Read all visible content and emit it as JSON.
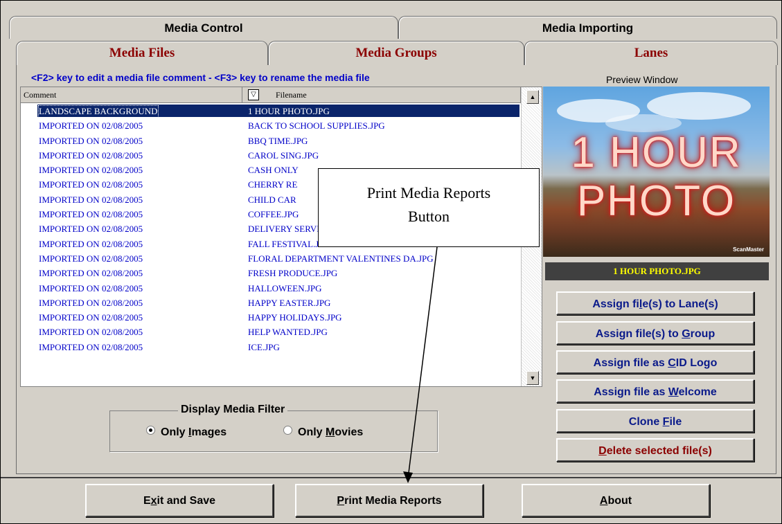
{
  "top_tabs": [
    "Media Control",
    "Media Importing"
  ],
  "sub_tabs": [
    "Media Files",
    "Media Groups",
    "Lanes"
  ],
  "hint": "<F2> key to edit a media file comment - <F3> key to rename the media file",
  "grid": {
    "columns": [
      "Comment",
      "Filename"
    ],
    "rows": [
      {
        "comment": "LANDSCAPE BACKGROUND",
        "filename": "1 HOUR PHOTO.JPG"
      },
      {
        "comment": "IMPORTED ON 02/08/2005",
        "filename": "BACK TO SCHOOL SUPPLIES.JPG"
      },
      {
        "comment": "IMPORTED ON 02/08/2005",
        "filename": "BBQ TIME.JPG"
      },
      {
        "comment": "IMPORTED ON 02/08/2005",
        "filename": "CAROL SING.JPG"
      },
      {
        "comment": "IMPORTED ON 02/08/2005",
        "filename": "CASH ONLY"
      },
      {
        "comment": "IMPORTED ON 02/08/2005",
        "filename": "CHERRY RE"
      },
      {
        "comment": "IMPORTED ON 02/08/2005",
        "filename": "CHILD CAR"
      },
      {
        "comment": "IMPORTED ON 02/08/2005",
        "filename": "COFFEE.JPG"
      },
      {
        "comment": "IMPORTED ON 02/08/2005",
        "filename": "DELIVERY SERVICE.JPG"
      },
      {
        "comment": "IMPORTED ON 02/08/2005",
        "filename": "FALL FESTIVAL.JPG"
      },
      {
        "comment": "IMPORTED ON 02/08/2005",
        "filename": "FLORAL DEPARTMENT VALENTINES DA.JPG"
      },
      {
        "comment": "IMPORTED ON 02/08/2005",
        "filename": "FRESH PRODUCE.JPG"
      },
      {
        "comment": "IMPORTED ON 02/08/2005",
        "filename": "HALLOWEEN.JPG"
      },
      {
        "comment": "IMPORTED ON 02/08/2005",
        "filename": "HAPPY EASTER.JPG"
      },
      {
        "comment": "IMPORTED ON 02/08/2005",
        "filename": "HAPPY HOLIDAYS.JPG"
      },
      {
        "comment": "IMPORTED ON 02/08/2005",
        "filename": "HELP WANTED.JPG"
      },
      {
        "comment": "IMPORTED ON 02/08/2005",
        "filename": "ICE.JPG"
      }
    ]
  },
  "filter": {
    "label": "Display Media Filter",
    "options": [
      {
        "pre": "Only ",
        "key": "I",
        "post": "mages",
        "selected": true
      },
      {
        "pre": "Only ",
        "key": "M",
        "post": "ovies",
        "selected": false
      }
    ]
  },
  "preview": {
    "label": "Preview Window",
    "line1": "1 HOUR",
    "line2": "PHOTO",
    "brand": "ScanMaster",
    "filename": "1 HOUR PHOTO.JPG"
  },
  "right_buttons": [
    {
      "pre": "Assign fi",
      "key": "l",
      "post": "e(s) to Lane(s)"
    },
    {
      "pre": "Assign file(s) to ",
      "key": "G",
      "post": "roup"
    },
    {
      "pre": "Assign file as ",
      "key": "C",
      "post": "ID Logo"
    },
    {
      "pre": "Assign file as ",
      "key": "W",
      "post": "elcome"
    },
    {
      "pre": "Clone ",
      "key": "F",
      "post": "ile"
    },
    {
      "pre": "",
      "key": "D",
      "post": "elete selected file(s)"
    }
  ],
  "bottom_buttons": [
    {
      "pre": "E",
      "key": "x",
      "post": "it and Save"
    },
    {
      "pre": "",
      "key": "P",
      "post": "rint Media Reports"
    },
    {
      "pre": "",
      "key": "A",
      "post": "bout"
    }
  ],
  "callout": {
    "line1": "Print Media Reports",
    "line2": "Button"
  },
  "colors": {
    "window_bg": "#d4d0c8",
    "tab_text_red": "#8b0000",
    "hint_blue": "#0000c8",
    "selection": "#0a246a",
    "filename_bar": "#404040",
    "filename_text": "#ffff00"
  }
}
